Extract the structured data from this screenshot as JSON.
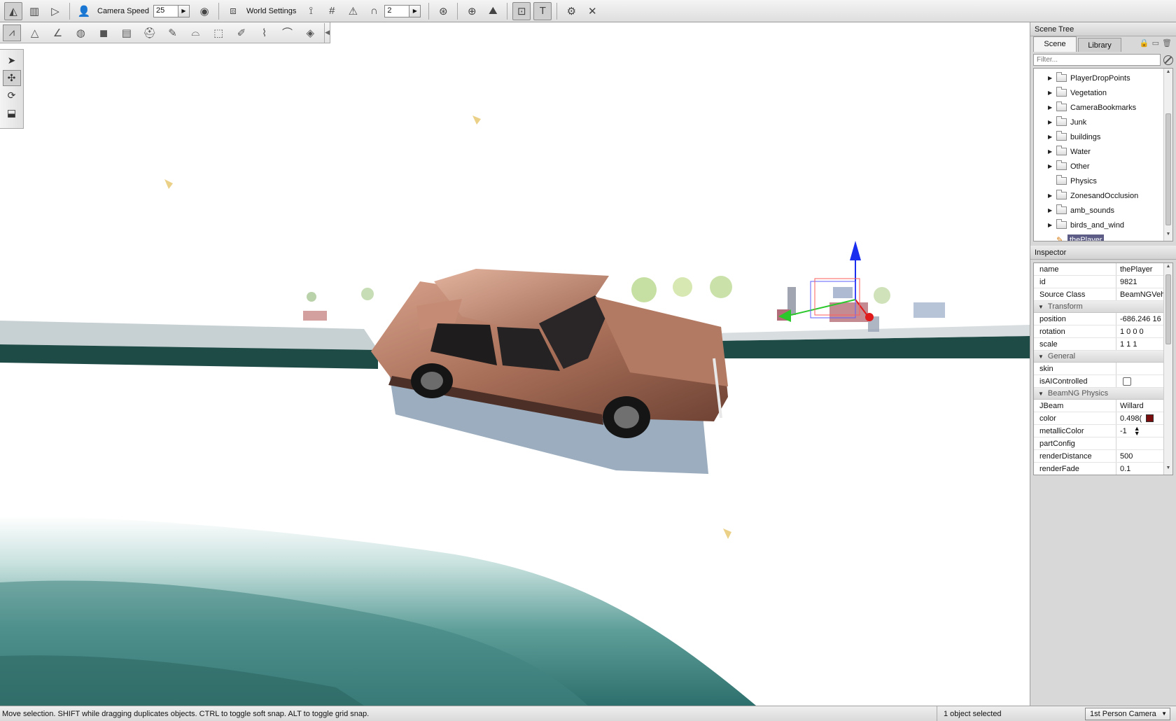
{
  "toolbar": {
    "camera_speed_label": "Camera Speed",
    "camera_speed_value": "25",
    "world_settings_label": "World Settings",
    "snap_value": "2"
  },
  "scene_tree": {
    "title": "Scene Tree",
    "tabs": [
      {
        "label": "Scene"
      },
      {
        "label": "Library"
      }
    ],
    "filter_placeholder": "Filter...",
    "items": [
      {
        "label": "PlayerDropPoints"
      },
      {
        "label": "Vegetation"
      },
      {
        "label": "CameraBookmarks"
      },
      {
        "label": "Junk"
      },
      {
        "label": "buildings"
      },
      {
        "label": "Water"
      },
      {
        "label": "Other"
      },
      {
        "label": "Physics"
      },
      {
        "label": "ZonesandOcclusion"
      },
      {
        "label": "amb_sounds"
      },
      {
        "label": "birds_and_wind"
      },
      {
        "label": "thePlayer"
      }
    ]
  },
  "inspector": {
    "title": "Inspector",
    "rows": {
      "name": {
        "key": "name",
        "value": "thePlayer"
      },
      "id": {
        "key": "id",
        "value": "9821"
      },
      "source_class": {
        "key": "Source Class",
        "value": "BeamNGVeh"
      },
      "position": {
        "key": "position",
        "value": "-686.246 16"
      },
      "rotation": {
        "key": "rotation",
        "value": "1 0 0 0"
      },
      "scale": {
        "key": "scale",
        "value": "1 1 1"
      },
      "skin": {
        "key": "skin",
        "value": ""
      },
      "is_ai": {
        "key": "isAIControlled",
        "value": ""
      },
      "jbeam": {
        "key": "JBeam",
        "value": "Willard"
      },
      "color": {
        "key": "color",
        "value": "0.498("
      },
      "metallic": {
        "key": "metallicColor",
        "value": "-1"
      },
      "part_config": {
        "key": "partConfig",
        "value": ""
      },
      "render_distance": {
        "key": "renderDistance",
        "value": "500"
      },
      "render_fade": {
        "key": "renderFade",
        "value": "0.1"
      }
    },
    "groups": {
      "transform": "Transform",
      "general": "General",
      "beamng": "BeamNG Physics"
    },
    "color_swatch": "#7a0e0e"
  },
  "status": {
    "message": "Move selection.  SHIFT while dragging duplicates objects.  CTRL to toggle soft snap.  ALT to toggle grid snap.",
    "selection": "1 object selected",
    "camera_mode": "1st Person Camera"
  }
}
